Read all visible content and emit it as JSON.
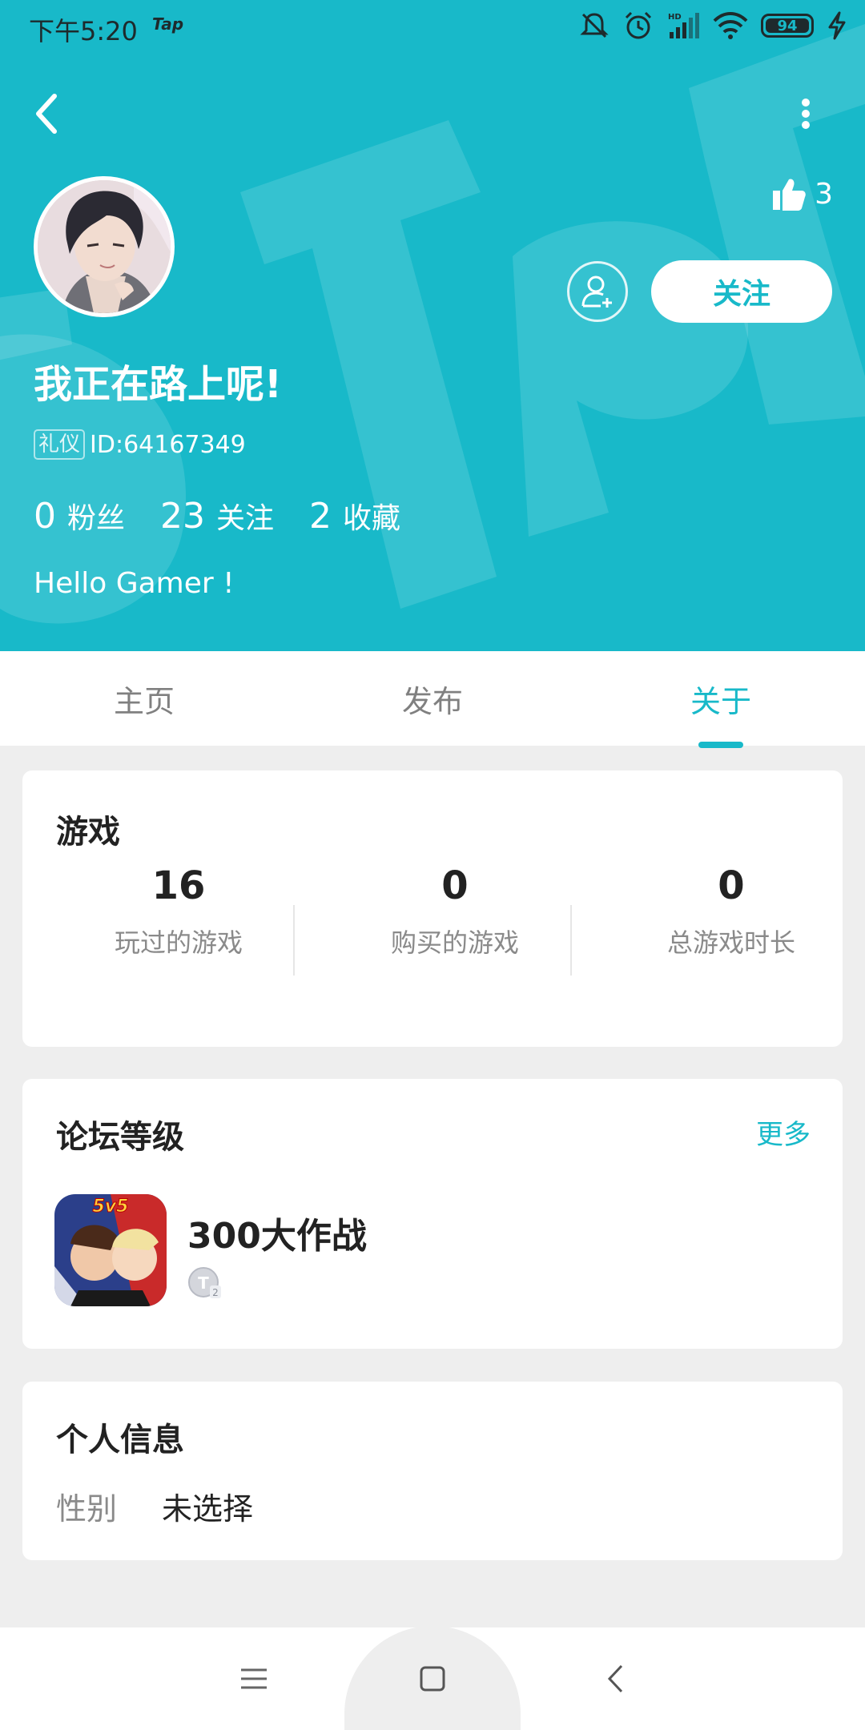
{
  "colors": {
    "accent": "#18b9c9",
    "background": "#eeeeee",
    "card": "#ffffff"
  },
  "status_bar": {
    "time": "下午5:20",
    "app_badge": "Tap",
    "battery": "94",
    "icons": [
      "mute-icon",
      "alarm-icon",
      "hd-signal-icon",
      "wifi-icon",
      "battery-icon",
      "charging-icon"
    ]
  },
  "header": {
    "like_count": "3",
    "follow_label": "关注",
    "nickname": "我正在路上呢!",
    "badge_label": "礼仪",
    "user_id": "ID:64167349",
    "stats": [
      {
        "value": "0",
        "label": "粉丝"
      },
      {
        "value": "23",
        "label": "关注"
      },
      {
        "value": "2",
        "label": "收藏"
      }
    ],
    "bio": "Hello Gamer !"
  },
  "tabs": [
    {
      "label": "主页",
      "active": false
    },
    {
      "label": "发布",
      "active": false
    },
    {
      "label": "关于",
      "active": true
    }
  ],
  "games_card": {
    "title": "游戏",
    "stats": [
      {
        "value": "16",
        "label": "玩过的游戏"
      },
      {
        "value": "0",
        "label": "购买的游戏"
      },
      {
        "value": "0",
        "label": "总游戏时长"
      }
    ]
  },
  "forum_card": {
    "title": "论坛等级",
    "more_label": "更多",
    "game_name": "300大作战",
    "game_icon_text": "5v5",
    "level_badge": "T2"
  },
  "personal_card": {
    "title": "个人信息",
    "rows": [
      {
        "label": "性别",
        "value": "未选择"
      }
    ]
  },
  "nav_bar": {
    "buttons": [
      "menu-icon",
      "home-icon",
      "back-icon"
    ]
  }
}
